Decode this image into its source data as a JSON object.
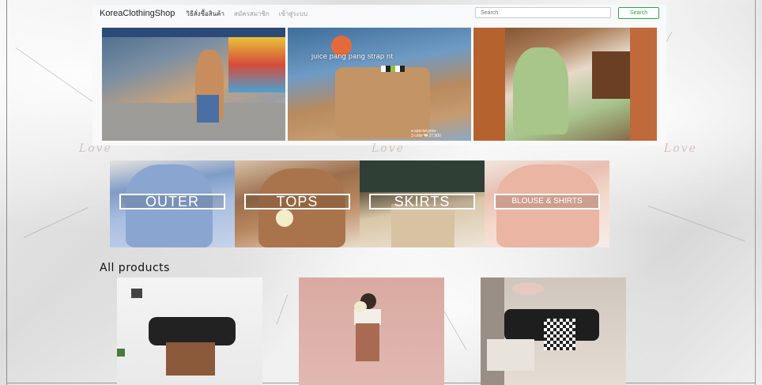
{
  "navbar": {
    "brand": "KoreaClothingShop",
    "links": [
      "วิธีสั่งซื้อสินค้า",
      "สมัครสมาชิก",
      "เข้าสู่ระบบ"
    ],
    "search_placeholder": "Search",
    "search_button": "Search"
  },
  "banner": {
    "slide2_caption": "juice pang pang strap nt",
    "slide2_sub_lines": [
      "a special price",
      "3 color  ₩ 27,500"
    ]
  },
  "decor": {
    "love": "Love"
  },
  "categories": [
    {
      "label": "OUTER"
    },
    {
      "label": "TOPS"
    },
    {
      "label": "SKIRTS"
    },
    {
      "label": "BLOUSE & SHIRTS"
    }
  ],
  "products_section": {
    "title": "All products"
  },
  "colors": {
    "search_button_border": "#28a745",
    "nav_background": "#f8f9fa"
  }
}
